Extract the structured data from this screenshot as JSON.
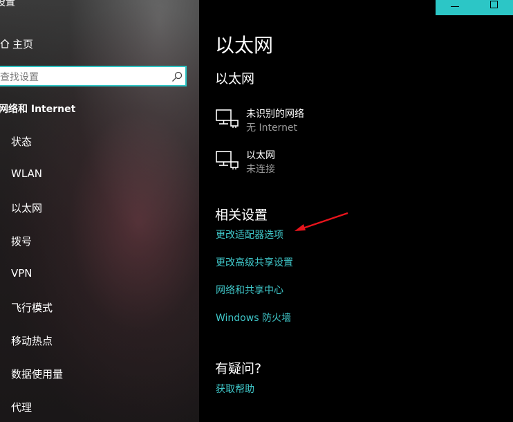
{
  "sidebar": {
    "title": "设置",
    "home_label": "主页",
    "search_placeholder": "查找设置",
    "category": "网络和 Internet",
    "items": [
      {
        "label": "状态"
      },
      {
        "label": "WLAN"
      },
      {
        "label": "以太网"
      },
      {
        "label": "拨号"
      },
      {
        "label": "VPN"
      },
      {
        "label": "飞行模式"
      },
      {
        "label": "移动热点"
      },
      {
        "label": "数据使用量"
      },
      {
        "label": "代理"
      }
    ]
  },
  "main": {
    "page_title": "以太网",
    "section_title": "以太网",
    "networks": [
      {
        "name": "未识别的网络",
        "status": "无 Internet"
      },
      {
        "name": "以太网",
        "status": "未连接"
      }
    ],
    "related_title": "相关设置",
    "related_links": [
      {
        "label": "更改适配器选项"
      },
      {
        "label": "更改高级共享设置"
      },
      {
        "label": "网络和共享中心"
      },
      {
        "label": "Windows 防火墙"
      }
    ],
    "question_title": "有疑问?",
    "help_link": "获取帮助"
  },
  "colors": {
    "accent": "#3fc6c8",
    "window_controls": "#2cc6c6",
    "annotation_arrow": "#e8141c"
  }
}
